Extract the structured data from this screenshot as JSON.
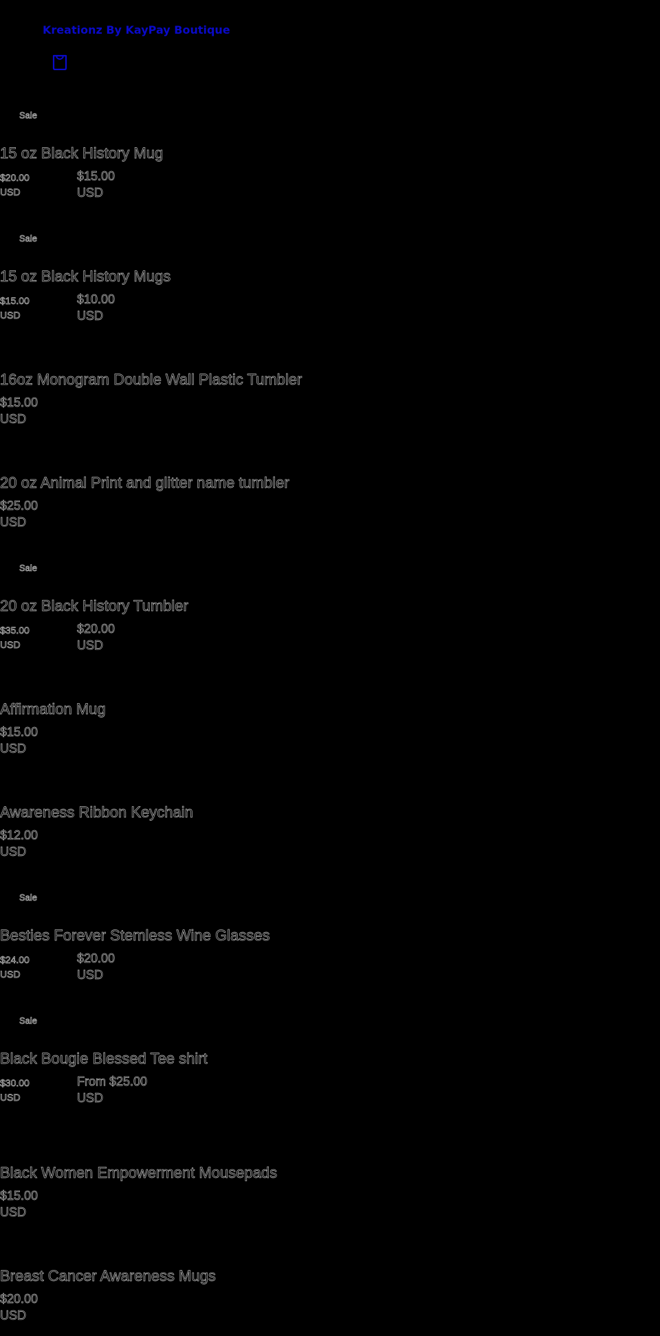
{
  "header": {
    "brand": "Kreationz By KayPay Boutique",
    "cart_icon": "shopping-bag-icon",
    "brand_color": "#0a0ac8"
  },
  "products": [
    {
      "sale_label": "Sale",
      "title": "15 oz Black History Mug",
      "compare_price": "$20.00",
      "compare_currency": "USD",
      "price": "$15.00",
      "currency": "USD"
    },
    {
      "sale_label": "Sale",
      "title": "15 oz Black History Mugs",
      "compare_price": "$15.00",
      "compare_currency": "USD",
      "price": "$10.00",
      "currency": "USD"
    },
    {
      "title": "16oz Monogram Double Wall Plastic Tumbler",
      "price": "$15.00",
      "currency": "USD"
    },
    {
      "title": "20 oz Animal Print and glitter name tumbler",
      "price": "$25.00",
      "currency": "USD"
    },
    {
      "sale_label": "Sale",
      "title": "20 oz Black History Tumbler",
      "compare_price": "$35.00",
      "compare_currency": "USD",
      "price": "$20.00",
      "currency": "USD"
    },
    {
      "title": "Affirmation Mug",
      "price": "$15.00",
      "currency": "USD"
    },
    {
      "title": "Awareness Ribbon Keychain",
      "price": "$12.00",
      "currency": "USD"
    },
    {
      "sale_label": "Sale",
      "title": "Besties Forever Stemless Wine Glasses",
      "compare_price": "$24.00",
      "compare_currency": "USD",
      "price": "$20.00",
      "currency": "USD"
    },
    {
      "sale_label": "Sale",
      "title": "Black Bougie Blessed Tee shirt",
      "compare_price": "$30.00",
      "compare_currency": "USD",
      "price": "From $25.00",
      "currency": "USD"
    },
    {
      "title": "Black Women Empowerment Mousepads",
      "price": "$15.00",
      "currency": "USD"
    },
    {
      "title": "Breast Cancer Awareness Mugs",
      "price": "$20.00",
      "currency": "USD"
    }
  ]
}
